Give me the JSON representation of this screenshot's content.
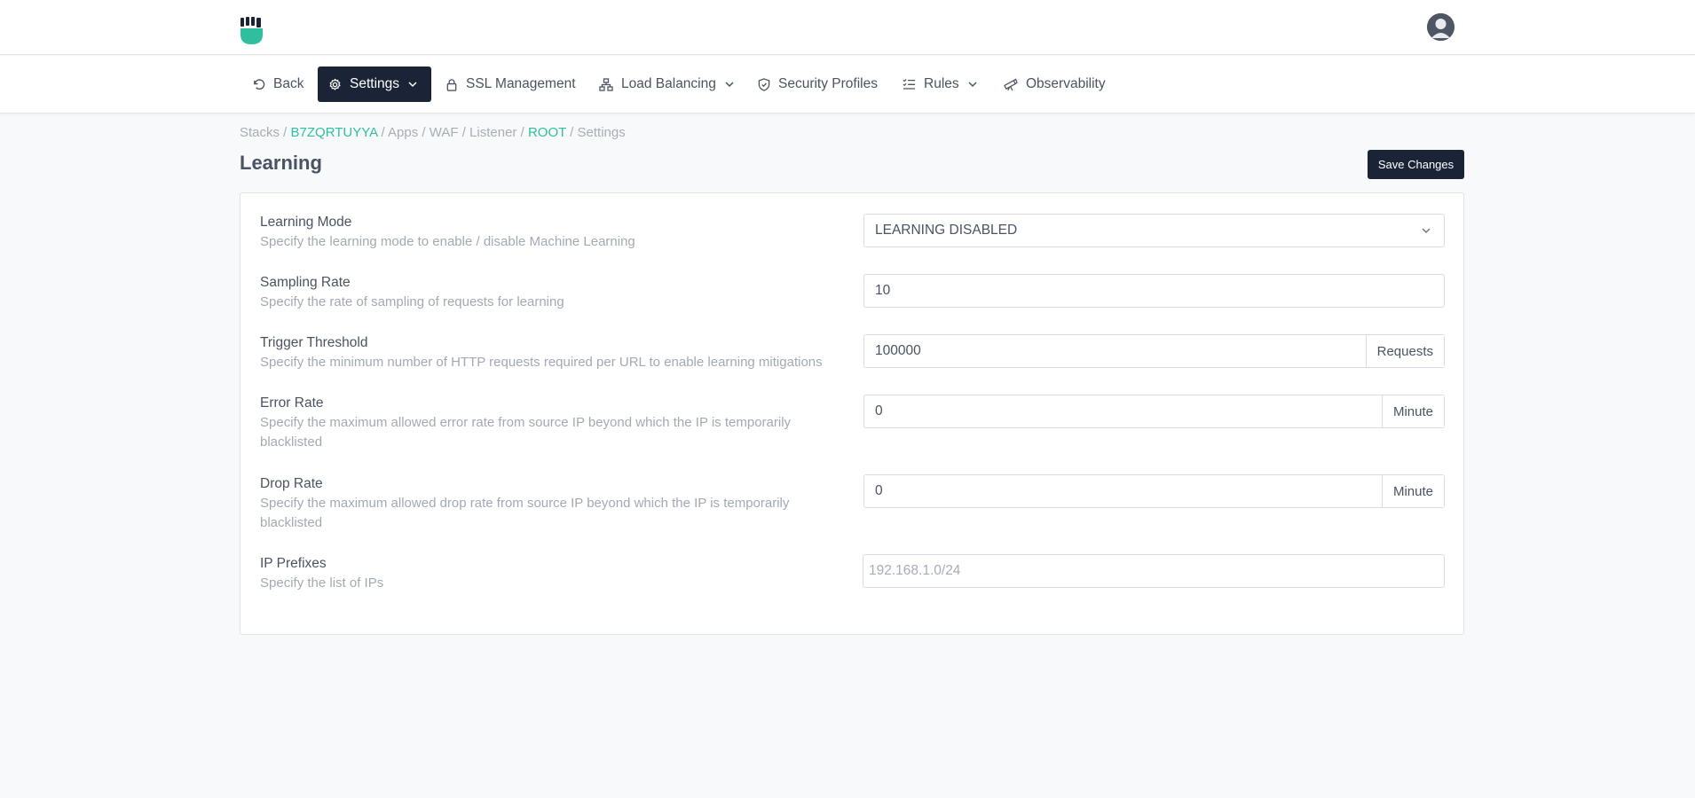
{
  "colors": {
    "accent": "#2fbf9e",
    "dark": "#1b2437",
    "text": "#4a5361",
    "muted": "#a3a9b3"
  },
  "nav": {
    "back": "Back",
    "settings": "Settings",
    "ssl": "SSL Management",
    "load_balancing": "Load Balancing",
    "security_profiles": "Security Profiles",
    "rules": "Rules",
    "observability": "Observability"
  },
  "breadcrumb": [
    {
      "text": "Stacks",
      "link": false
    },
    {
      "text": "B7ZQRTUYYA",
      "link": true
    },
    {
      "text": "Apps",
      "link": false
    },
    {
      "text": "WAF",
      "link": false
    },
    {
      "text": "Listener",
      "link": false
    },
    {
      "text": "ROOT",
      "link": true
    },
    {
      "text": "Settings",
      "link": false
    }
  ],
  "page": {
    "title": "Learning",
    "save_label": "Save Changes"
  },
  "form": {
    "learning_mode": {
      "label": "Learning Mode",
      "desc": "Specify the learning mode to enable / disable Machine Learning",
      "value": "LEARNING DISABLED"
    },
    "sampling_rate": {
      "label": "Sampling Rate",
      "desc": "Specify the rate of sampling of requests for learning",
      "value": "10"
    },
    "trigger_threshold": {
      "label": "Trigger Threshold",
      "desc": "Specify the minimum number of HTTP requests required per URL to enable learning mitigations",
      "value": "100000",
      "unit": "Requests"
    },
    "error_rate": {
      "label": "Error Rate",
      "desc": "Specify the maximum allowed error rate from source IP beyond which the IP is temporarily blacklisted",
      "value": "0",
      "unit": "Minute"
    },
    "drop_rate": {
      "label": "Drop Rate",
      "desc": "Specify the maximum allowed drop rate from source IP beyond which the IP is temporarily blacklisted",
      "value": "0",
      "unit": "Minute"
    },
    "ip_prefixes": {
      "label": "IP Prefixes",
      "desc": "Specify the list of IPs",
      "placeholder": "192.168.1.0/24"
    }
  }
}
